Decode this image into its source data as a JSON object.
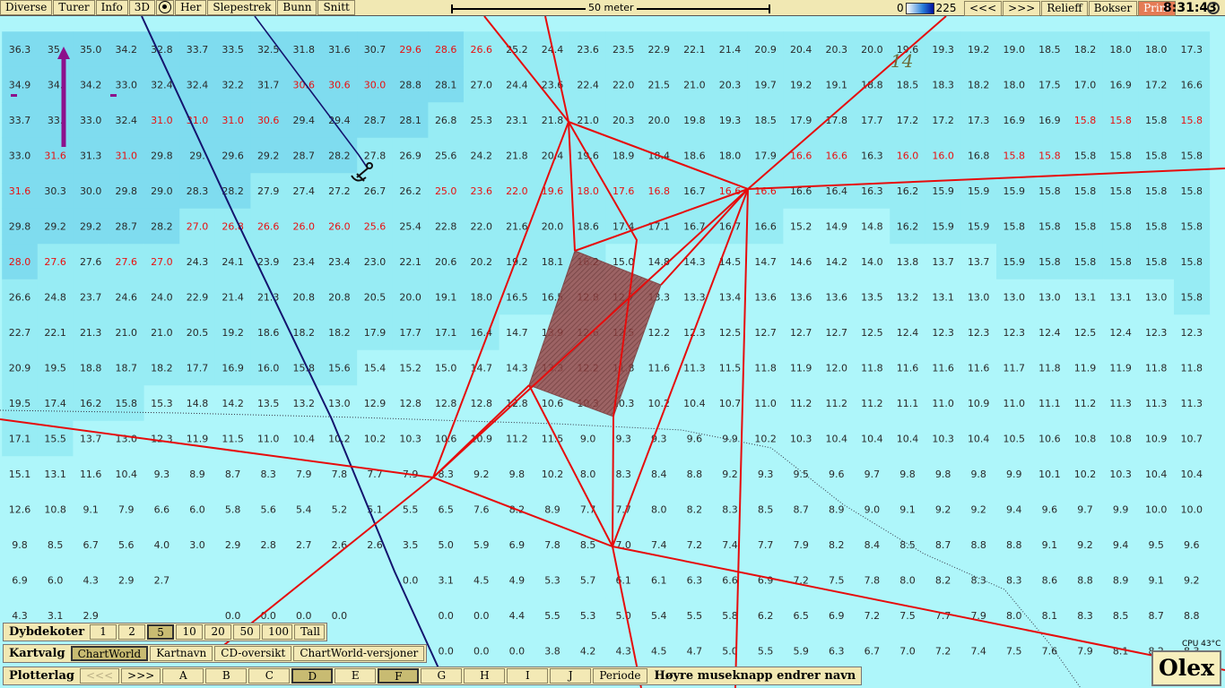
{
  "toolbar": {
    "left_buttons": [
      "Diverse",
      "Turer",
      "Info",
      "3D",
      "Her",
      "Slepestrek",
      "Bunn",
      "Snitt"
    ],
    "scale_label": "50 meter",
    "depth_min": "0",
    "depth_max": "225",
    "right_buttons": [
      "<<<",
      ">>>",
      "Relieff",
      "Bokser",
      "Print"
    ],
    "clock": "8:31:43"
  },
  "map": {
    "marker_label": "14",
    "colors": {
      "water_light": "#aef6fa",
      "water_mid": "#97ecf4",
      "water_deep": "#7fdcef",
      "route": "#e81010",
      "track": "#101070",
      "highlight_box": "#8e3a3a"
    },
    "depth_grid": {
      "rows": [
        [
          "36.3",
          "35.",
          "35.0",
          "34.2",
          "32.8",
          "33.7",
          "33.5",
          "32.5",
          "31.8",
          "31.6",
          "30.7",
          "29.6",
          "28.6",
          "26.6",
          "25.2",
          "24.4",
          "23.6",
          "23.5",
          "22.9",
          "22.1",
          "21.4",
          "20.9",
          "20.4",
          "20.3",
          "20.0",
          "19.6",
          "19.3",
          "19.2",
          "19.0",
          "18.5",
          "18.2",
          "18.0",
          "18.0",
          "17.3"
        ],
        [
          "34.9",
          "34.",
          "34.2",
          "33.0",
          "32.4",
          "32.4",
          "32.2",
          "31.7",
          "30.6",
          "30.6",
          "30.0",
          "28.8",
          "28.1",
          "27.0",
          "24.4",
          "23.6",
          "22.4",
          "22.0",
          "21.5",
          "21.0",
          "20.3",
          "19.7",
          "19.2",
          "19.1",
          "18.8",
          "18.5",
          "18.3",
          "18.2",
          "18.0",
          "17.5",
          "17.0",
          "16.9",
          "17.2",
          "16.6"
        ],
        [
          "33.7",
          "33.",
          "33.0",
          "32.4",
          "31.0",
          "31.0",
          "31.0",
          "30.6",
          "29.4",
          "29.4",
          "28.7",
          "28.1",
          "26.8",
          "25.3",
          "23.1",
          "21.8",
          "21.0",
          "20.3",
          "20.0",
          "19.8",
          "19.3",
          "18.5",
          "17.9",
          "17.8",
          "17.7",
          "17.2",
          "17.2",
          "17.3",
          "16.9",
          "16.9",
          "15.8",
          "15.8",
          "15.8",
          "15.8"
        ],
        [
          "33.0",
          "31.6",
          "31.3",
          "31.0",
          "29.8",
          "29.",
          "29.6",
          "29.2",
          "28.7",
          "28.2",
          "27.8",
          "26.9",
          "25.6",
          "24.2",
          "21.8",
          "20.4",
          "19.6",
          "18.9",
          "18.4",
          "18.6",
          "18.0",
          "17.9",
          "16.6",
          "16.6",
          "16.3",
          "16.0",
          "16.0",
          "16.8",
          "15.8",
          "15.8",
          "15.8",
          "15.8",
          "15.8",
          "15.8"
        ],
        [
          "31.6",
          "30.3",
          "30.0",
          "29.8",
          "29.0",
          "28.3",
          "28.2",
          "27.9",
          "27.4",
          "27.2",
          "26.7",
          "26.2",
          "25.0",
          "23.6",
          "22.0",
          "19.6",
          "18.0",
          "17.6",
          "16.8",
          "16.7",
          "16.6",
          "16.6",
          "16.6",
          "16.4",
          "16.3",
          "16.2",
          "15.9",
          "15.9",
          "15.9",
          "15.8",
          "15.8",
          "15.8",
          "15.8",
          "15.8"
        ],
        [
          "29.8",
          "29.2",
          "29.2",
          "28.7",
          "28.2",
          "27.0",
          "26.8",
          "26.6",
          "26.0",
          "26.0",
          "25.6",
          "25.4",
          "22.8",
          "22.0",
          "21.6",
          "20.0",
          "18.6",
          "17.4",
          "17.1",
          "16.7",
          "16.7",
          "16.6",
          "15.2",
          "14.9",
          "14.8",
          "16.2",
          "15.9",
          "15.9",
          "15.8",
          "15.8",
          "15.8",
          "15.8",
          "15.8",
          "15.8"
        ],
        [
          "28.0",
          "27.6",
          "27.6",
          "27.6",
          "27.0",
          "24.3",
          "24.1",
          "23.9",
          "23.4",
          "23.4",
          "23.0",
          "22.1",
          "20.6",
          "20.2",
          "19.2",
          "18.1",
          "16.2",
          "15.0",
          "14.8",
          "14.3",
          "14.5",
          "14.7",
          "14.6",
          "14.2",
          "14.0",
          "13.8",
          "13.7",
          "13.7",
          "15.9",
          "15.8",
          "15.8",
          "15.8",
          "15.8",
          "15.8"
        ],
        [
          "26.6",
          "24.8",
          "23.7",
          "24.6",
          "24.0",
          "22.9",
          "21.4",
          "21.3",
          "20.8",
          "20.8",
          "20.5",
          "20.0",
          "19.1",
          "18.0",
          "16.5",
          "16.5",
          "12.8",
          "12.7",
          "13.3",
          "13.3",
          "13.4",
          "13.6",
          "13.6",
          "13.6",
          "13.5",
          "13.2",
          "13.1",
          "13.0",
          "13.0",
          "13.0",
          "13.1",
          "13.1",
          "13.0",
          "15.8"
        ],
        [
          "22.7",
          "22.1",
          "21.3",
          "21.0",
          "21.0",
          "20.5",
          "19.2",
          "18.6",
          "18.2",
          "18.2",
          "17.9",
          "17.7",
          "17.1",
          "16.4",
          "14.7",
          "13.9",
          "12.6",
          "12.5",
          "12.2",
          "12.3",
          "12.5",
          "12.7",
          "12.7",
          "12.7",
          "12.5",
          "12.4",
          "12.3",
          "12.3",
          "12.3",
          "12.4",
          "12.5",
          "12.4",
          "12.3",
          "12.3"
        ],
        [
          "20.9",
          "19.5",
          "18.8",
          "18.7",
          "18.2",
          "17.7",
          "16.9",
          "16.0",
          "15.8",
          "15.6",
          "15.4",
          "15.2",
          "15.0",
          "14.7",
          "14.3",
          "13.3",
          "12.2",
          "11.8",
          "11.6",
          "11.3",
          "11.5",
          "11.8",
          "11.9",
          "12.0",
          "11.8",
          "11.6",
          "11.6",
          "11.6",
          "11.7",
          "11.8",
          "11.9",
          "11.9",
          "11.8",
          "11.8"
        ],
        [
          "19.5",
          "17.4",
          "16.2",
          "15.8",
          "15.3",
          "14.8",
          "14.2",
          "13.5",
          "13.2",
          "13.0",
          "12.9",
          "12.8",
          "12.8",
          "12.8",
          "12.8",
          "10.6",
          "10.3",
          "10.3",
          "10.2",
          "10.4",
          "10.7",
          "11.0",
          "11.2",
          "11.2",
          "11.2",
          "11.1",
          "11.0",
          "10.9",
          "11.0",
          "11.1",
          "11.2",
          "11.3",
          "11.3",
          "11.3"
        ],
        [
          "17.1",
          "15.5",
          "13.7",
          "13.0",
          "12.3",
          "11.9",
          "11.5",
          "11.0",
          "10.4",
          "10.2",
          "10.2",
          "10.3",
          "10.6",
          "10.9",
          "11.2",
          "11.5",
          "9.0",
          "9.3",
          "9.3",
          "9.6",
          "9.9",
          "10.2",
          "10.3",
          "10.4",
          "10.4",
          "10.4",
          "10.3",
          "10.4",
          "10.5",
          "10.6",
          "10.8",
          "10.8",
          "10.9",
          "10.7"
        ],
        [
          "15.1",
          "13.1",
          "11.6",
          "10.4",
          "9.3",
          "8.9",
          "8.7",
          "8.3",
          "7.9",
          "7.8",
          "7.7",
          "7.9",
          "8.3",
          "9.2",
          "9.8",
          "10.2",
          "8.0",
          "8.3",
          "8.4",
          "8.8",
          "9.2",
          "9.3",
          "9.5",
          "9.6",
          "9.7",
          "9.8",
          "9.8",
          "9.8",
          "9.9",
          "10.1",
          "10.2",
          "10.3",
          "10.4",
          "10.4"
        ],
        [
          "12.6",
          "10.8",
          "9.1",
          "7.9",
          "6.6",
          "6.0",
          "5.8",
          "5.6",
          "5.4",
          "5.2",
          "5.1",
          "5.5",
          "6.5",
          "7.6",
          "8.2",
          "8.9",
          "7.7",
          "7.7",
          "8.0",
          "8.2",
          "8.3",
          "8.5",
          "8.7",
          "8.9",
          "9.0",
          "9.1",
          "9.2",
          "9.2",
          "9.4",
          "9.6",
          "9.7",
          "9.9",
          "10.0",
          "10.0"
        ],
        [
          "9.8",
          "8.5",
          "6.7",
          "5.6",
          "4.0",
          "3.0",
          "2.9",
          "2.8",
          "2.7",
          "2.6",
          "2.6",
          "3.5",
          "5.0",
          "5.9",
          "6.9",
          "7.8",
          "8.5",
          "7.0",
          "7.4",
          "7.2",
          "7.4",
          "7.7",
          "7.9",
          "8.2",
          "8.4",
          "8.5",
          "8.7",
          "8.8",
          "8.8",
          "9.1",
          "9.2",
          "9.4",
          "9.5",
          "9.6"
        ],
        [
          "6.9",
          "6.0",
          "4.3",
          "2.9",
          "2.7",
          "",
          "",
          "",
          "",
          "",
          "",
          "0.0",
          "3.1",
          "4.5",
          "4.9",
          "5.3",
          "5.7",
          "6.1",
          "6.1",
          "6.3",
          "6.6",
          "6.9",
          "7.2",
          "7.5",
          "7.8",
          "8.0",
          "8.2",
          "8.3",
          "8.3",
          "8.6",
          "8.8",
          "8.9",
          "9.1",
          "9.2"
        ],
        [
          "4.3",
          "3.1",
          "2.9",
          "",
          "",
          "",
          "0.0",
          "0.0",
          "0.0",
          "0.0",
          "",
          "",
          "0.0",
          "0.0",
          "4.4",
          "5.5",
          "5.3",
          "5.0",
          "5.4",
          "5.5",
          "5.8",
          "6.2",
          "6.5",
          "6.9",
          "7.2",
          "7.5",
          "7.7",
          "7.9",
          "8.0",
          "8.1",
          "8.3",
          "8.5",
          "8.7",
          "8.8"
        ],
        [
          "",
          "",
          "",
          "",
          "",
          "",
          "",
          "",
          "",
          "",
          "0.0",
          "",
          "0.0",
          "0.0",
          "0.0",
          "3.8",
          "4.2",
          "4.3",
          "4.5",
          "4.7",
          "5.0",
          "5.5",
          "5.9",
          "6.3",
          "6.7",
          "7.0",
          "7.2",
          "7.4",
          "7.5",
          "7.6",
          "7.9",
          "8.1",
          "8.2",
          "8.3"
        ]
      ],
      "red_cells": [
        [
          0,
          11
        ],
        [
          0,
          12
        ],
        [
          0,
          13
        ],
        [
          1,
          8
        ],
        [
          1,
          9
        ],
        [
          1,
          10
        ],
        [
          2,
          4
        ],
        [
          2,
          5
        ],
        [
          2,
          6
        ],
        [
          2,
          7
        ],
        [
          2,
          30
        ],
        [
          2,
          31
        ],
        [
          2,
          33
        ],
        [
          3,
          1
        ],
        [
          3,
          3
        ],
        [
          3,
          22
        ],
        [
          3,
          23
        ],
        [
          3,
          25
        ],
        [
          3,
          26
        ],
        [
          3,
          28
        ],
        [
          3,
          29
        ],
        [
          4,
          0
        ],
        [
          4,
          12
        ],
        [
          4,
          13
        ],
        [
          4,
          14
        ],
        [
          4,
          15
        ],
        [
          4,
          16
        ],
        [
          4,
          17
        ],
        [
          4,
          18
        ],
        [
          4,
          20
        ],
        [
          4,
          21
        ],
        [
          5,
          5
        ],
        [
          5,
          6
        ],
        [
          5,
          7
        ],
        [
          5,
          8
        ],
        [
          5,
          9
        ],
        [
          5,
          10
        ],
        [
          6,
          0
        ],
        [
          6,
          1
        ],
        [
          6,
          3
        ],
        [
          6,
          4
        ]
      ]
    }
  },
  "panels": {
    "dybdekoter": {
      "title": "Dybdekoter",
      "buttons": [
        "1",
        "2",
        "5",
        "10",
        "20",
        "50",
        "100",
        "Tall"
      ],
      "selected": "5"
    },
    "kartvalg": {
      "title": "Kartvalg",
      "buttons": [
        "ChartWorld",
        "Kartnavn",
        "CD-oversikt",
        "ChartWorld-versjoner"
      ],
      "selected": "ChartWorld"
    },
    "plotterlag": {
      "title": "Plotterlag",
      "nav": [
        "<<<",
        ">>>"
      ],
      "layers": [
        "A",
        "B",
        "C",
        "D",
        "E",
        "F",
        "G",
        "H",
        "I",
        "J"
      ],
      "selected": [
        "D",
        "F"
      ],
      "period": "Periode",
      "hint": "Høyre museknapp endrer navn"
    }
  },
  "status": {
    "cpu": "CPU 43°C",
    "brand": "Olex"
  }
}
